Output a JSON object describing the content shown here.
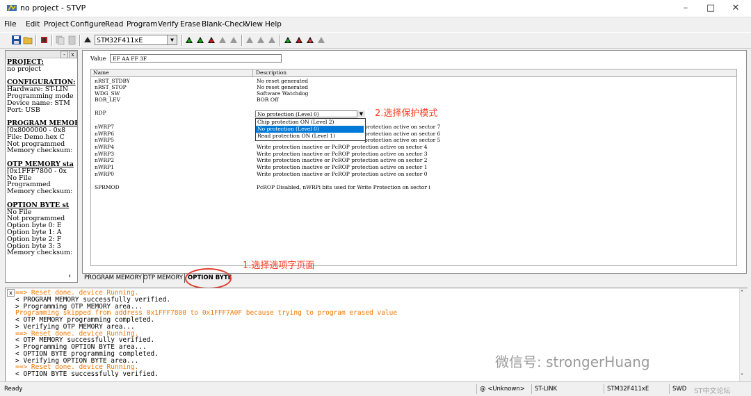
{
  "window": {
    "title": "no project - STVP"
  },
  "menu": [
    "File",
    "Edit",
    "Project",
    "Configure",
    "Read",
    "Program",
    "Verify",
    "Erase",
    "Blank-Check",
    "View",
    "Help"
  ],
  "toolbar": {
    "device": "STM32F411xE"
  },
  "left_panel": {
    "lines": [
      {
        "text": "PROJECT:",
        "bold": true
      },
      {
        "text": "no project"
      },
      {
        "text": ""
      },
      {
        "text": "CONFIGURATION:",
        "bold": true
      },
      {
        "text": "Hardware: ST-LIN"
      },
      {
        "text": "Programming mode"
      },
      {
        "text": "Device name: STM"
      },
      {
        "text": "Port: USB"
      },
      {
        "text": ""
      },
      {
        "text": "PROGRAM MEMORY",
        "bold": true
      },
      {
        "text": "[0x8000000 - 0x8"
      },
      {
        "text": "File: Demo.hex C"
      },
      {
        "text": "Not programmed"
      },
      {
        "text": "Memory checksum:"
      },
      {
        "text": ""
      },
      {
        "text": "OTP MEMORY sta",
        "bold": true
      },
      {
        "text": "[0x1FFF7800 - 0x"
      },
      {
        "text": "No File"
      },
      {
        "text": "Programmed"
      },
      {
        "text": "Memory checksum:"
      },
      {
        "text": ""
      },
      {
        "text": "OPTION BYTE st",
        "bold": true
      },
      {
        "text": "No File"
      },
      {
        "text": "Not programmed"
      },
      {
        "text": "Option byte 0: E"
      },
      {
        "text": "Option byte 1: A"
      },
      {
        "text": "Option byte 2: F"
      },
      {
        "text": "Option byte 3: 3"
      },
      {
        "text": "Memory checksum:"
      }
    ]
  },
  "option_byte": {
    "value_label": "Value",
    "value": "EF AA FF 3F",
    "col_name": "Name",
    "col_desc": "Description",
    "rows": [
      {
        "name": "nRST_STDBY",
        "desc": "No reset generated"
      },
      {
        "name": "nRST_STOP",
        "desc": "No reset generated"
      },
      {
        "name": "WDG_SW",
        "desc": "Software Watchdog"
      },
      {
        "name": "BOR_LEV",
        "desc": "BOR Off"
      },
      {
        "name": "RDP",
        "desc": ""
      },
      {
        "name": "nWRP7",
        "desc": "protection active on sector 7"
      },
      {
        "name": "nWRP6",
        "desc": "protection active on sector 6"
      },
      {
        "name": "nWRP5",
        "desc": "protection active on sector 5"
      },
      {
        "name": "nWRP4",
        "desc": "Write protection inactive or PcROP protection active on sector 4"
      },
      {
        "name": "nWRP3",
        "desc": "Write protection inactive or PcROP protection active on sector 3"
      },
      {
        "name": "nWRP2",
        "desc": "Write protection inactive or PcROP protection active on sector 2"
      },
      {
        "name": "nWRP1",
        "desc": "Write protection inactive or PcROP protection active on sector 1"
      },
      {
        "name": "nWRP0",
        "desc": "Write protection inactive or PcROP protection active on sector 0"
      },
      {
        "name": "SPRMOD",
        "desc": "PcROP Disabled, nWRPi bits used for Write Protection on sector i"
      }
    ],
    "rdp_selected": "No protection (Level 0)",
    "rdp_options": [
      "Chip protection ON (Level 2)",
      "No protection (Level 0)",
      "Read protection ON (Level 1)"
    ],
    "rdp_highlighted_index": 1
  },
  "annotations": {
    "step2": "2.选择保护模式",
    "step1": "1.选择选项字页面"
  },
  "tabs": [
    "PROGRAM MEMORY",
    "OTP MEMORY",
    "OPTION BYTE"
  ],
  "active_tab": "OPTION BYTE",
  "log": [
    {
      "text": "==> Reset done. device Running.",
      "warn": true
    },
    {
      "text": "< PROGRAM MEMORY successfully verified."
    },
    {
      "text": "> Programming  OTP MEMORY area..."
    },
    {
      "text": "Programming skipped from address 0x1FFF7800 to 0x1FFF7A0F because trying to program erased value",
      "warn": true
    },
    {
      "text": "< OTP MEMORY programming completed."
    },
    {
      "text": "> Verifying OTP MEMORY area..."
    },
    {
      "text": "==> Reset done. device Running.",
      "warn": true
    },
    {
      "text": "< OTP MEMORY successfully verified."
    },
    {
      "text": "> Programming  OPTION BYTE area..."
    },
    {
      "text": "< OPTION BYTE programming completed."
    },
    {
      "text": "> Verifying OPTION BYTE area..."
    },
    {
      "text": "==> Reset done. device Running.",
      "warn": true
    },
    {
      "text": "< OPTION BYTE successfully verified."
    }
  ],
  "status": {
    "ready": "Ready",
    "conn": "@ <Unknown>",
    "tool": "ST-LINK",
    "device": "STM32F411xE",
    "proto": "SWD"
  },
  "watermark": {
    "main": "微信号: strongerHuang",
    "forum": "ST中文论坛"
  }
}
